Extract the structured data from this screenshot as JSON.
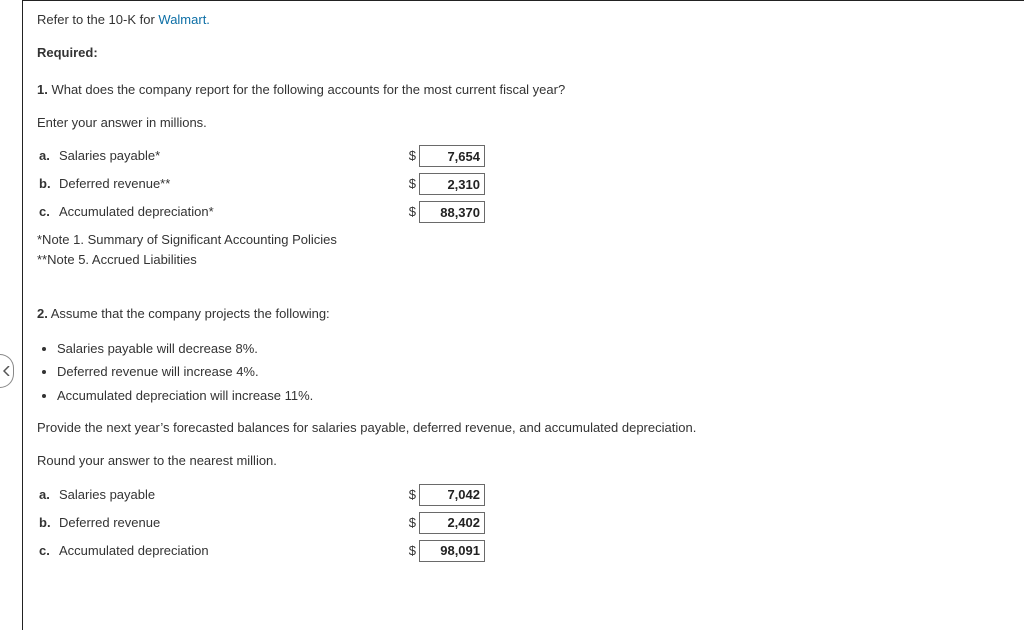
{
  "refer": {
    "prefix": "Refer to the 10-K for ",
    "link_text": "Walmart.",
    "link_color": "#0d6fa6"
  },
  "required_label": "Required:",
  "q1": {
    "number": "1.",
    "text": " What does the company report for the following accounts for the most current fiscal year?",
    "instruction": "Enter your answer in millions.",
    "rows": [
      {
        "letter": "a.",
        "label": "Salaries payable*",
        "value": "7,654"
      },
      {
        "letter": "b.",
        "label": "Deferred revenue**",
        "value": "2,310"
      },
      {
        "letter": "c.",
        "label": "Accumulated depreciation*",
        "value": "88,370"
      }
    ],
    "note1": "*Note 1. Summary of Significant Accounting Policies",
    "note2": "**Note 5. Accrued Liabilities"
  },
  "q2": {
    "number": "2.",
    "text": " Assume that the company projects the following:",
    "bullets": [
      "Salaries payable will decrease 8%.",
      "Deferred revenue will increase 4%.",
      "Accumulated depreciation will increase 11%."
    ],
    "provide": "Provide the next year’s forecasted balances for salaries payable, deferred revenue, and accumulated depreciation.",
    "round": "Round your answer to the nearest million.",
    "rows": [
      {
        "letter": "a.",
        "label": "Salaries payable",
        "value": "7,042"
      },
      {
        "letter": "b.",
        "label": "Deferred revenue",
        "value": "2,402"
      },
      {
        "letter": "c.",
        "label": "Accumulated depreciation",
        "value": "98,091"
      }
    ]
  }
}
